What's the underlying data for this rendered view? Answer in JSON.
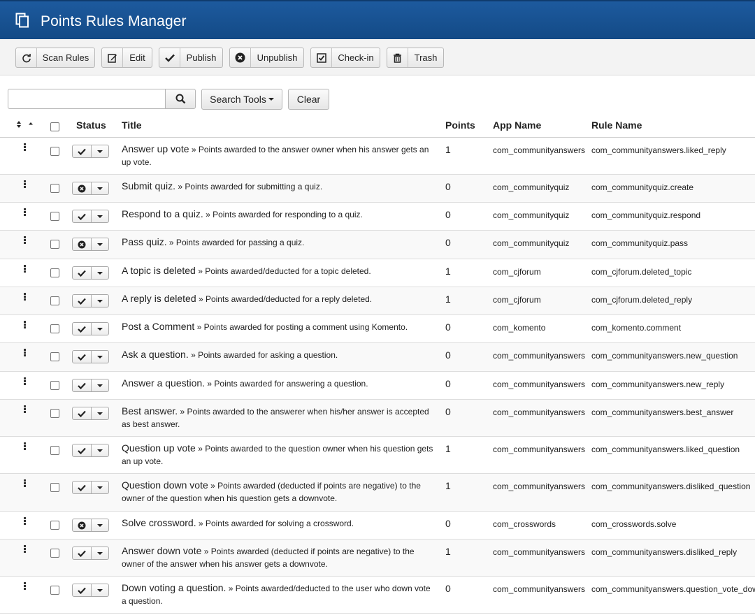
{
  "header": {
    "title": "Points Rules Manager",
    "icon": "copy-icon"
  },
  "toolbar": {
    "scan_rules": "Scan Rules",
    "edit": "Edit",
    "publish": "Publish",
    "unpublish": "Unpublish",
    "checkin": "Check-in",
    "trash": "Trash"
  },
  "search": {
    "placeholder": "",
    "value": "",
    "search_tools": "Search Tools",
    "clear": "Clear"
  },
  "table": {
    "columns": {
      "status": "Status",
      "title": "Title",
      "points": "Points",
      "app_name": "App Name",
      "rule_name": "Rule Name"
    },
    "rows": [
      {
        "title": "Answer up vote",
        "desc": " » Points awarded to the answer owner when his answer gets an up vote.",
        "points": "1",
        "app": "com_communityanswers",
        "rule": "com_communityanswers.liked_reply",
        "published": true
      },
      {
        "title": "Submit quiz.",
        "desc": " » Points awarded for submitting a quiz.",
        "points": "0",
        "app": "com_communityquiz",
        "rule": "com_communityquiz.create",
        "published": false
      },
      {
        "title": "Respond to a quiz.",
        "desc": " » Points awarded for responding to a quiz.",
        "points": "0",
        "app": "com_communityquiz",
        "rule": "com_communityquiz.respond",
        "published": true
      },
      {
        "title": "Pass quiz.",
        "desc": " » Points awarded for passing a quiz.",
        "points": "0",
        "app": "com_communityquiz",
        "rule": "com_communityquiz.pass",
        "published": false
      },
      {
        "title": "A topic is deleted",
        "desc": " » Points awarded/deducted for a topic deleted.",
        "points": "1",
        "app": "com_cjforum",
        "rule": "com_cjforum.deleted_topic",
        "published": true
      },
      {
        "title": "A reply is deleted",
        "desc": " » Points awarded/deducted for a reply deleted.",
        "points": "1",
        "app": "com_cjforum",
        "rule": "com_cjforum.deleted_reply",
        "published": true
      },
      {
        "title": "Post a Comment",
        "desc": " » Points awarded for posting a comment using Komento.",
        "points": "0",
        "app": "com_komento",
        "rule": "com_komento.comment",
        "published": true
      },
      {
        "title": "Ask a question.",
        "desc": " » Points awarded for asking a question.",
        "points": "0",
        "app": "com_communityanswers",
        "rule": "com_communityanswers.new_question",
        "published": true
      },
      {
        "title": "Answer a question.",
        "desc": " » Points awarded for answering a question.",
        "points": "0",
        "app": "com_communityanswers",
        "rule": "com_communityanswers.new_reply",
        "published": true
      },
      {
        "title": "Best answer.",
        "desc": " » Points awarded to the answerer when his/her answer is accepted as best answer.",
        "points": "0",
        "app": "com_communityanswers",
        "rule": "com_communityanswers.best_answer",
        "published": true
      },
      {
        "title": "Question up vote",
        "desc": " » Points awarded to the question owner when his question gets an up vote.",
        "points": "1",
        "app": "com_communityanswers",
        "rule": "com_communityanswers.liked_question",
        "published": true
      },
      {
        "title": "Question down vote",
        "desc": " » Points awarded (deducted if points are negative) to the owner of the question when his question gets a downvote.",
        "points": "1",
        "app": "com_communityanswers",
        "rule": "com_communityanswers.disliked_question",
        "published": true
      },
      {
        "title": "Solve crossword.",
        "desc": " » Points awarded for solving a crossword.",
        "points": "0",
        "app": "com_crosswords",
        "rule": "com_crosswords.solve",
        "published": false
      },
      {
        "title": "Answer down vote",
        "desc": " » Points awarded (deducted if points are negative) to the owner of the answer when his answer gets a downvote.",
        "points": "1",
        "app": "com_communityanswers",
        "rule": "com_communityanswers.disliked_reply",
        "published": true
      },
      {
        "title": "Down voting a question.",
        "desc": " » Points awarded/deducted to the user who down vote a question.",
        "points": "0",
        "app": "com_communityanswers",
        "rule": "com_communityanswers.question_vote_down",
        "published": true
      }
    ]
  }
}
